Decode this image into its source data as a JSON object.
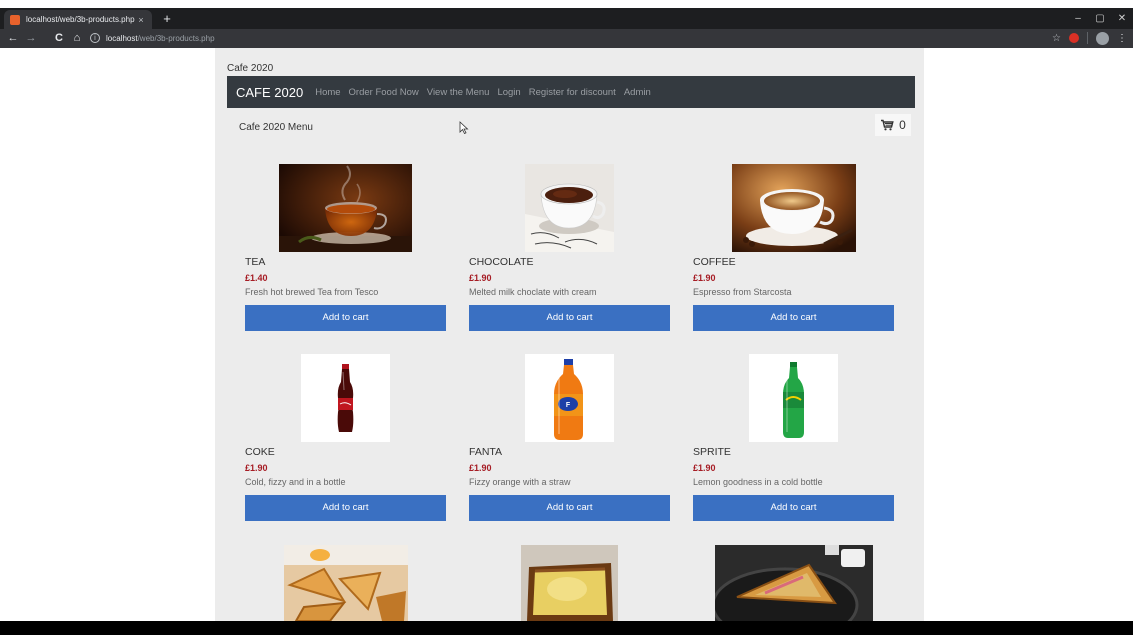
{
  "browser": {
    "tab_title": "localhost/web/3b-products.php",
    "tab_close": "×",
    "new_tab": "+",
    "url_host": "localhost",
    "url_path": "/web/3b-products.php",
    "back": "←",
    "forward": "→",
    "reload": "C",
    "home": "⌂",
    "star": "☆",
    "menu": "⋮",
    "win_min": "–",
    "win_max": "▢",
    "win_close": "✕"
  },
  "site": {
    "label": "Cafe 2020",
    "brand": "CAFE 2020",
    "nav": [
      "Home",
      "Order Food Now",
      "View the Menu",
      "Login",
      "Register for discount",
      "Admin"
    ],
    "menu_title": "Cafe 2020 Menu",
    "cart_count": "0",
    "add_to_cart": "Add to cart"
  },
  "products": [
    {
      "name": "TEA",
      "price": "£1.40",
      "desc": "Fresh hot brewed Tea from Tesco",
      "image": "tea-cup"
    },
    {
      "name": "CHOCOLATE",
      "price": "£1.90",
      "desc": "Melted milk choclate with cream",
      "image": "hot-chocolate-cup"
    },
    {
      "name": "COFFEE",
      "price": "£1.90",
      "desc": "Espresso from Starcosta",
      "image": "coffee-cup"
    },
    {
      "name": "COKE",
      "price": "£1.90",
      "desc": "Cold, fizzy and in a bottle",
      "image": "coke-bottle"
    },
    {
      "name": "FANTA",
      "price": "£1.90",
      "desc": "Fizzy orange with a straw",
      "image": "fanta-bottle"
    },
    {
      "name": "SPRITE",
      "price": "£1.90",
      "desc": "Lemon goodness in a cold bottle",
      "image": "sprite-bottle"
    }
  ],
  "colors": {
    "navbar": "#343a40",
    "button": "#3a70c2",
    "price": "#a61c24",
    "page_bg": "#ececec"
  }
}
